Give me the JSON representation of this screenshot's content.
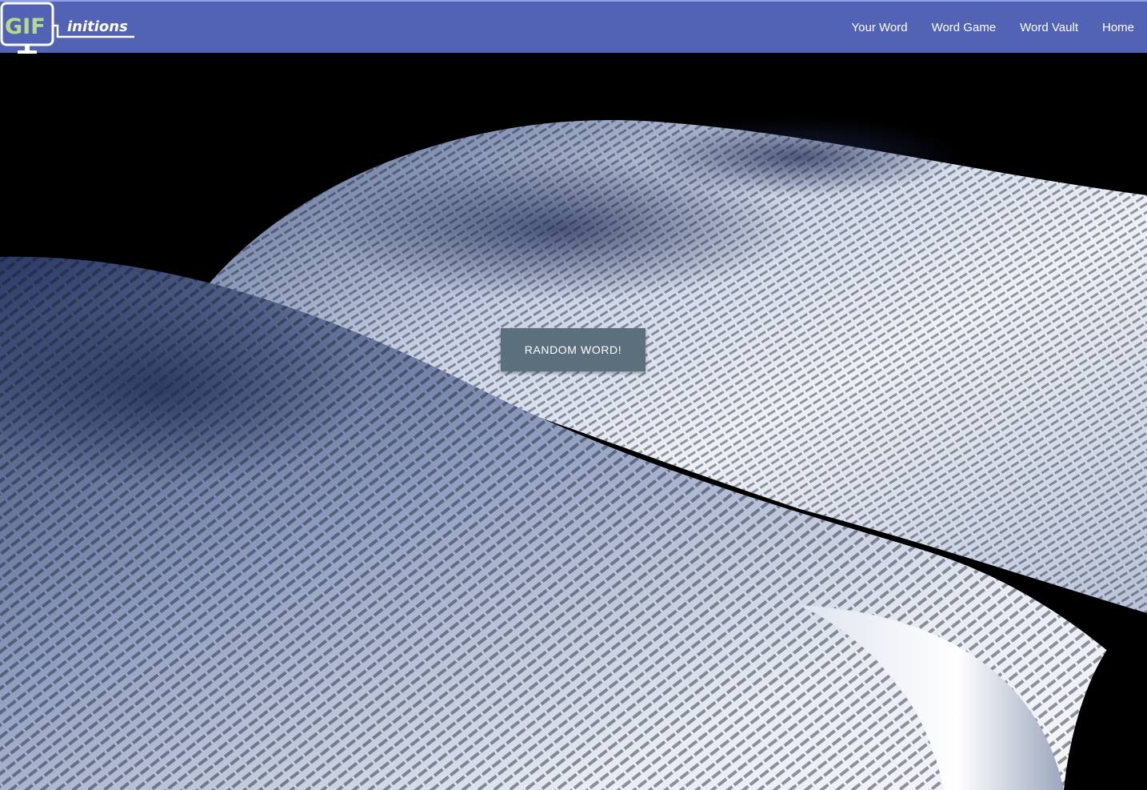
{
  "brand": {
    "logo_text_main": "GIF",
    "logo_text_suffix": "initions"
  },
  "nav": {
    "items": [
      {
        "label": "Your Word"
      },
      {
        "label": "Word Game"
      },
      {
        "label": "Word Vault"
      },
      {
        "label": "Home"
      }
    ]
  },
  "hero": {
    "random_button_label": "RANDOM WORD!",
    "background_description_icon": "open-dictionary-photo"
  },
  "colors": {
    "navbar": "#5262b4",
    "button": "#5b6f7c",
    "logo_green": "#b9d98a"
  }
}
